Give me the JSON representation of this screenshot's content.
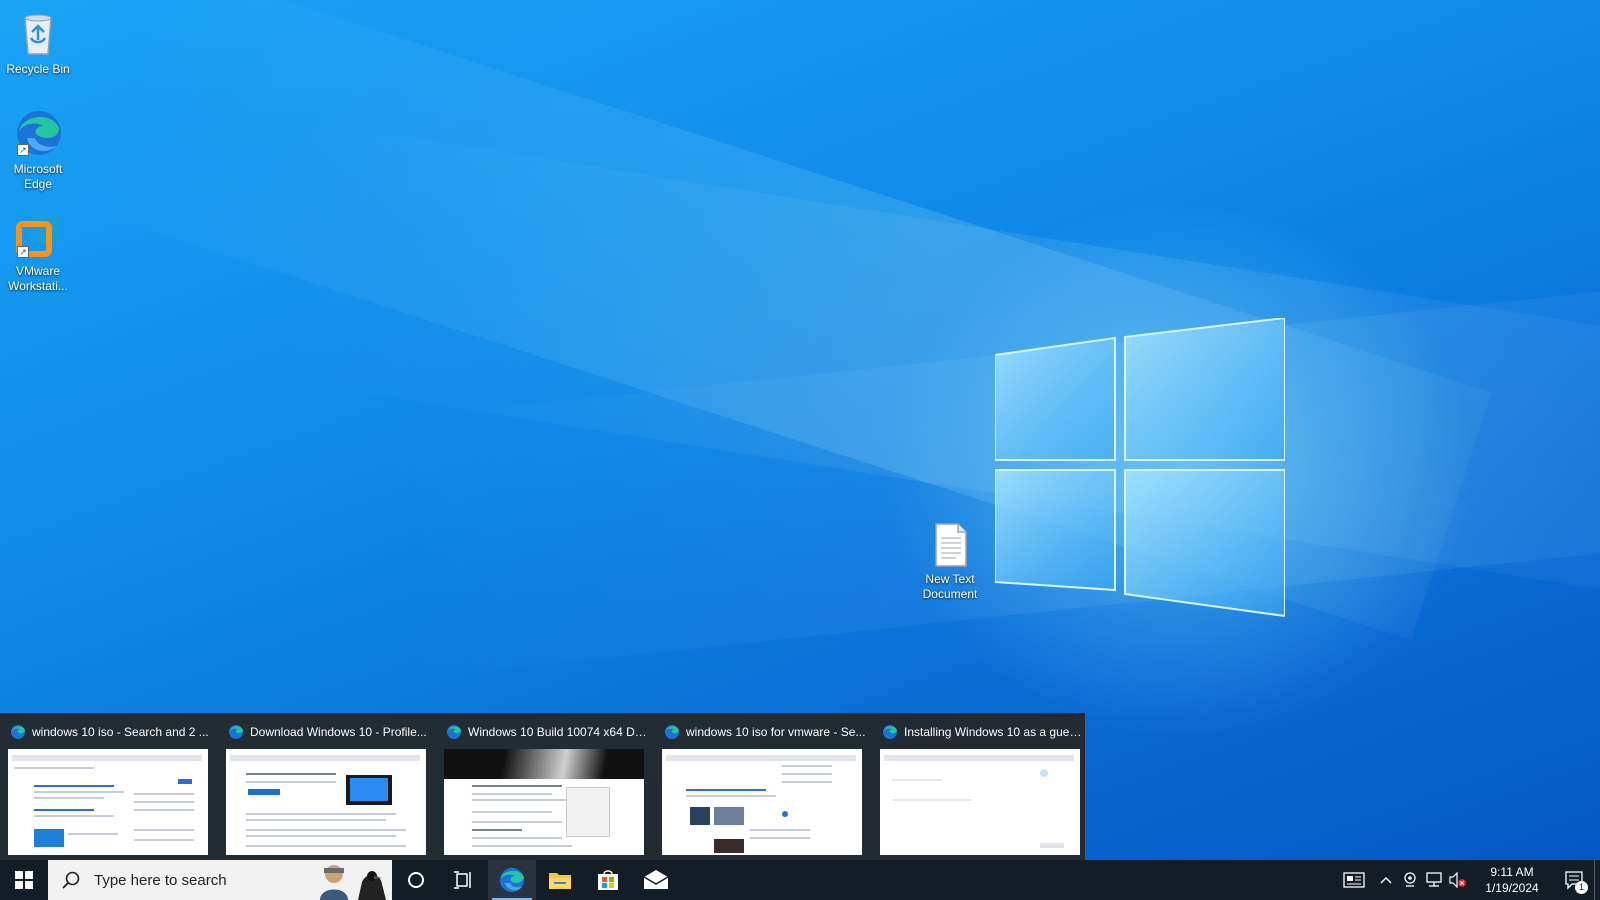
{
  "desktop": {
    "icons": [
      {
        "label": "Recycle Bin",
        "icon": "recycle-bin-icon"
      },
      {
        "label": "Microsoft Edge",
        "icon": "edge-icon"
      },
      {
        "label": "VMware Workstati...",
        "icon": "vmware-icon"
      },
      {
        "label": "New Text Document",
        "icon": "text-document-icon"
      }
    ]
  },
  "thumbnails": [
    {
      "title": "windows 10 iso - Search and 2 ...",
      "icon": "edge-icon"
    },
    {
      "title": "Download Windows 10 - Profile...",
      "icon": "edge-icon"
    },
    {
      "title": "Windows 10 Build 10074 x64 De...",
      "icon": "edge-icon"
    },
    {
      "title": "windows 10 iso for vmware - Se...",
      "icon": "edge-icon"
    },
    {
      "title": "Installing Windows 10 as a gues...",
      "icon": "edge-icon"
    }
  ],
  "taskbar": {
    "search_placeholder": "Type here to search",
    "pinned": [
      {
        "name": "edge",
        "icon": "edge-icon",
        "active": true
      },
      {
        "name": "file-explorer",
        "icon": "folder-icon",
        "active": false
      },
      {
        "name": "microsoft-store",
        "icon": "store-icon",
        "active": false
      },
      {
        "name": "mail",
        "icon": "mail-icon",
        "active": false
      }
    ],
    "clock": {
      "time": "9:11 AM",
      "date": "1/19/2024"
    },
    "notification_count": "1"
  },
  "colors": {
    "taskbar_bg": "#141c26",
    "wallpaper_blue": "#0f8ae8",
    "edge_teal": "#1fb8a8",
    "edge_blue": "#1a73d9"
  }
}
